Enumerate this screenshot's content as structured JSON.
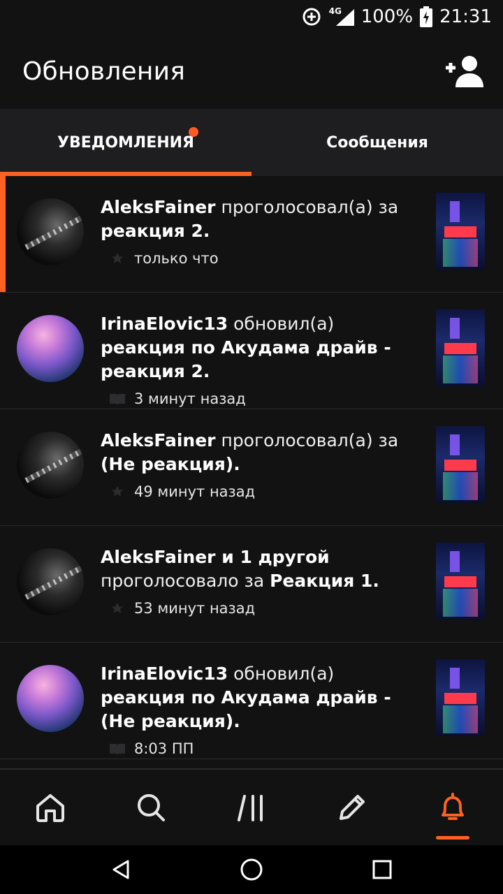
{
  "status_bar": {
    "network": "4G",
    "battery": "100%",
    "time": "21:31",
    "icons": [
      "data-saver-icon",
      "signal-icon",
      "battery-charging-icon"
    ]
  },
  "app_bar": {
    "title": "Обновления",
    "add_user_icon": "person-add-icon"
  },
  "tabs": [
    {
      "label": "УВЕДОМЛЕНИЯ",
      "active": true,
      "badge": true
    },
    {
      "label": "Сообщения",
      "active": false,
      "badge": false
    }
  ],
  "colors": {
    "accent": "#ff6122",
    "background": "#121212",
    "tabs_bg": "#1e1e20"
  },
  "notifications": [
    {
      "unread": true,
      "avatar": "guitar",
      "user": "AleksFainer",
      "action": "проголосовал(а) за",
      "target": "реакция 2.",
      "target_bold": true,
      "icon": "star-icon",
      "time": "только что"
    },
    {
      "unread": false,
      "avatar": "girl",
      "user": "IrinaElovic13",
      "action": "обновил(а)",
      "target": "реакция по Акудама драйв - реакция 2.",
      "target_bold": true,
      "icon": "book-icon",
      "time": "3 минут назад"
    },
    {
      "unread": false,
      "avatar": "guitar",
      "user": "AleksFainer",
      "action": "проголосовал(а) за",
      "target": "(Не реакция).",
      "target_bold": true,
      "icon": "star-icon",
      "time": "49 минут назад"
    },
    {
      "unread": false,
      "avatar": "guitar",
      "user": "AleksFainer и 1 другой",
      "action": "проголосовало за",
      "target": "Реакция 1.",
      "target_bold": true,
      "icon": "star-icon",
      "time": "53 минут назад"
    },
    {
      "unread": false,
      "avatar": "girl",
      "user": "IrinaElovic13",
      "action": "обновил(а)",
      "target": "реакция по Акудама драйв - (Не реакция).",
      "target_bold": true,
      "icon": "book-icon",
      "time": "8:03 ПП"
    }
  ],
  "bottom_nav": [
    {
      "name": "home-icon",
      "active": false
    },
    {
      "name": "search-icon",
      "active": false
    },
    {
      "name": "library-icon",
      "active": false
    },
    {
      "name": "write-icon",
      "active": false
    },
    {
      "name": "bell-icon",
      "active": true
    }
  ],
  "system_nav": [
    "back-icon",
    "home-circle-icon",
    "recents-icon"
  ]
}
